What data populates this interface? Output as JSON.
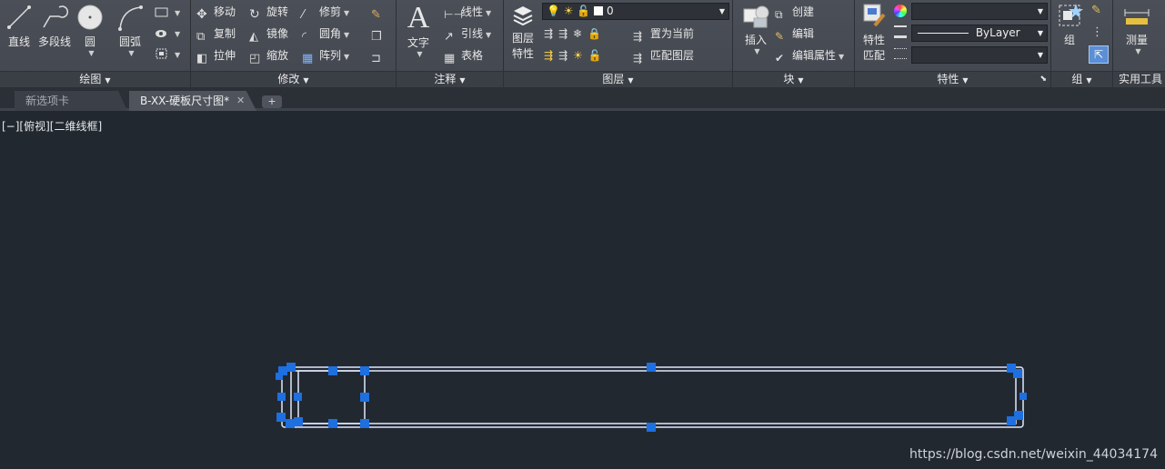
{
  "ribbon": {
    "draw": {
      "line": "直线",
      "polyline": "多段线",
      "circle": "圆",
      "arc": "圆弧",
      "footer": "绘图"
    },
    "modify": {
      "move": "移动",
      "rotate": "旋转",
      "trim": "修剪",
      "copy": "复制",
      "mirror": "镜像",
      "fillet": "圆角",
      "stretch": "拉伸",
      "scale": "缩放",
      "array": "阵列",
      "footer": "修改"
    },
    "annotation": {
      "text": "文字",
      "linear": "线性",
      "leader": "引线",
      "table": "表格",
      "footer": "注释"
    },
    "layers": {
      "layer_props_line1": "图层",
      "layer_props_line2": "特性",
      "current_layer": "0",
      "set_current": "置为当前",
      "match_layer": "匹配图层",
      "footer": "图层"
    },
    "block": {
      "insert": "插入",
      "create": "创建",
      "edit": "编辑",
      "edit_attributes": "编辑属性",
      "footer": "块"
    },
    "properties": {
      "match_line1": "特性",
      "match_line2": "匹配",
      "color_value": "",
      "linetype_value": "ByLayer",
      "lineweight_value": "",
      "footer": "特性"
    },
    "groups": {
      "group": "组",
      "footer": "组"
    },
    "utilities": {
      "measure": "测量",
      "footer": "实用工具"
    }
  },
  "tabs": [
    {
      "label": "新选项卡",
      "active": false
    },
    {
      "label": "B-XX-硬板尺寸图*",
      "active": true
    }
  ],
  "viewport": {
    "label": "[−][俯视][二维线框]"
  },
  "watermark": "https://blog.csdn.net/weixin_44034174",
  "colors": {
    "ribbon_bg": "#454950",
    "canvas_bg": "#212830",
    "grip": "#1e6fe0",
    "selection_line": "#dfe8ff"
  }
}
